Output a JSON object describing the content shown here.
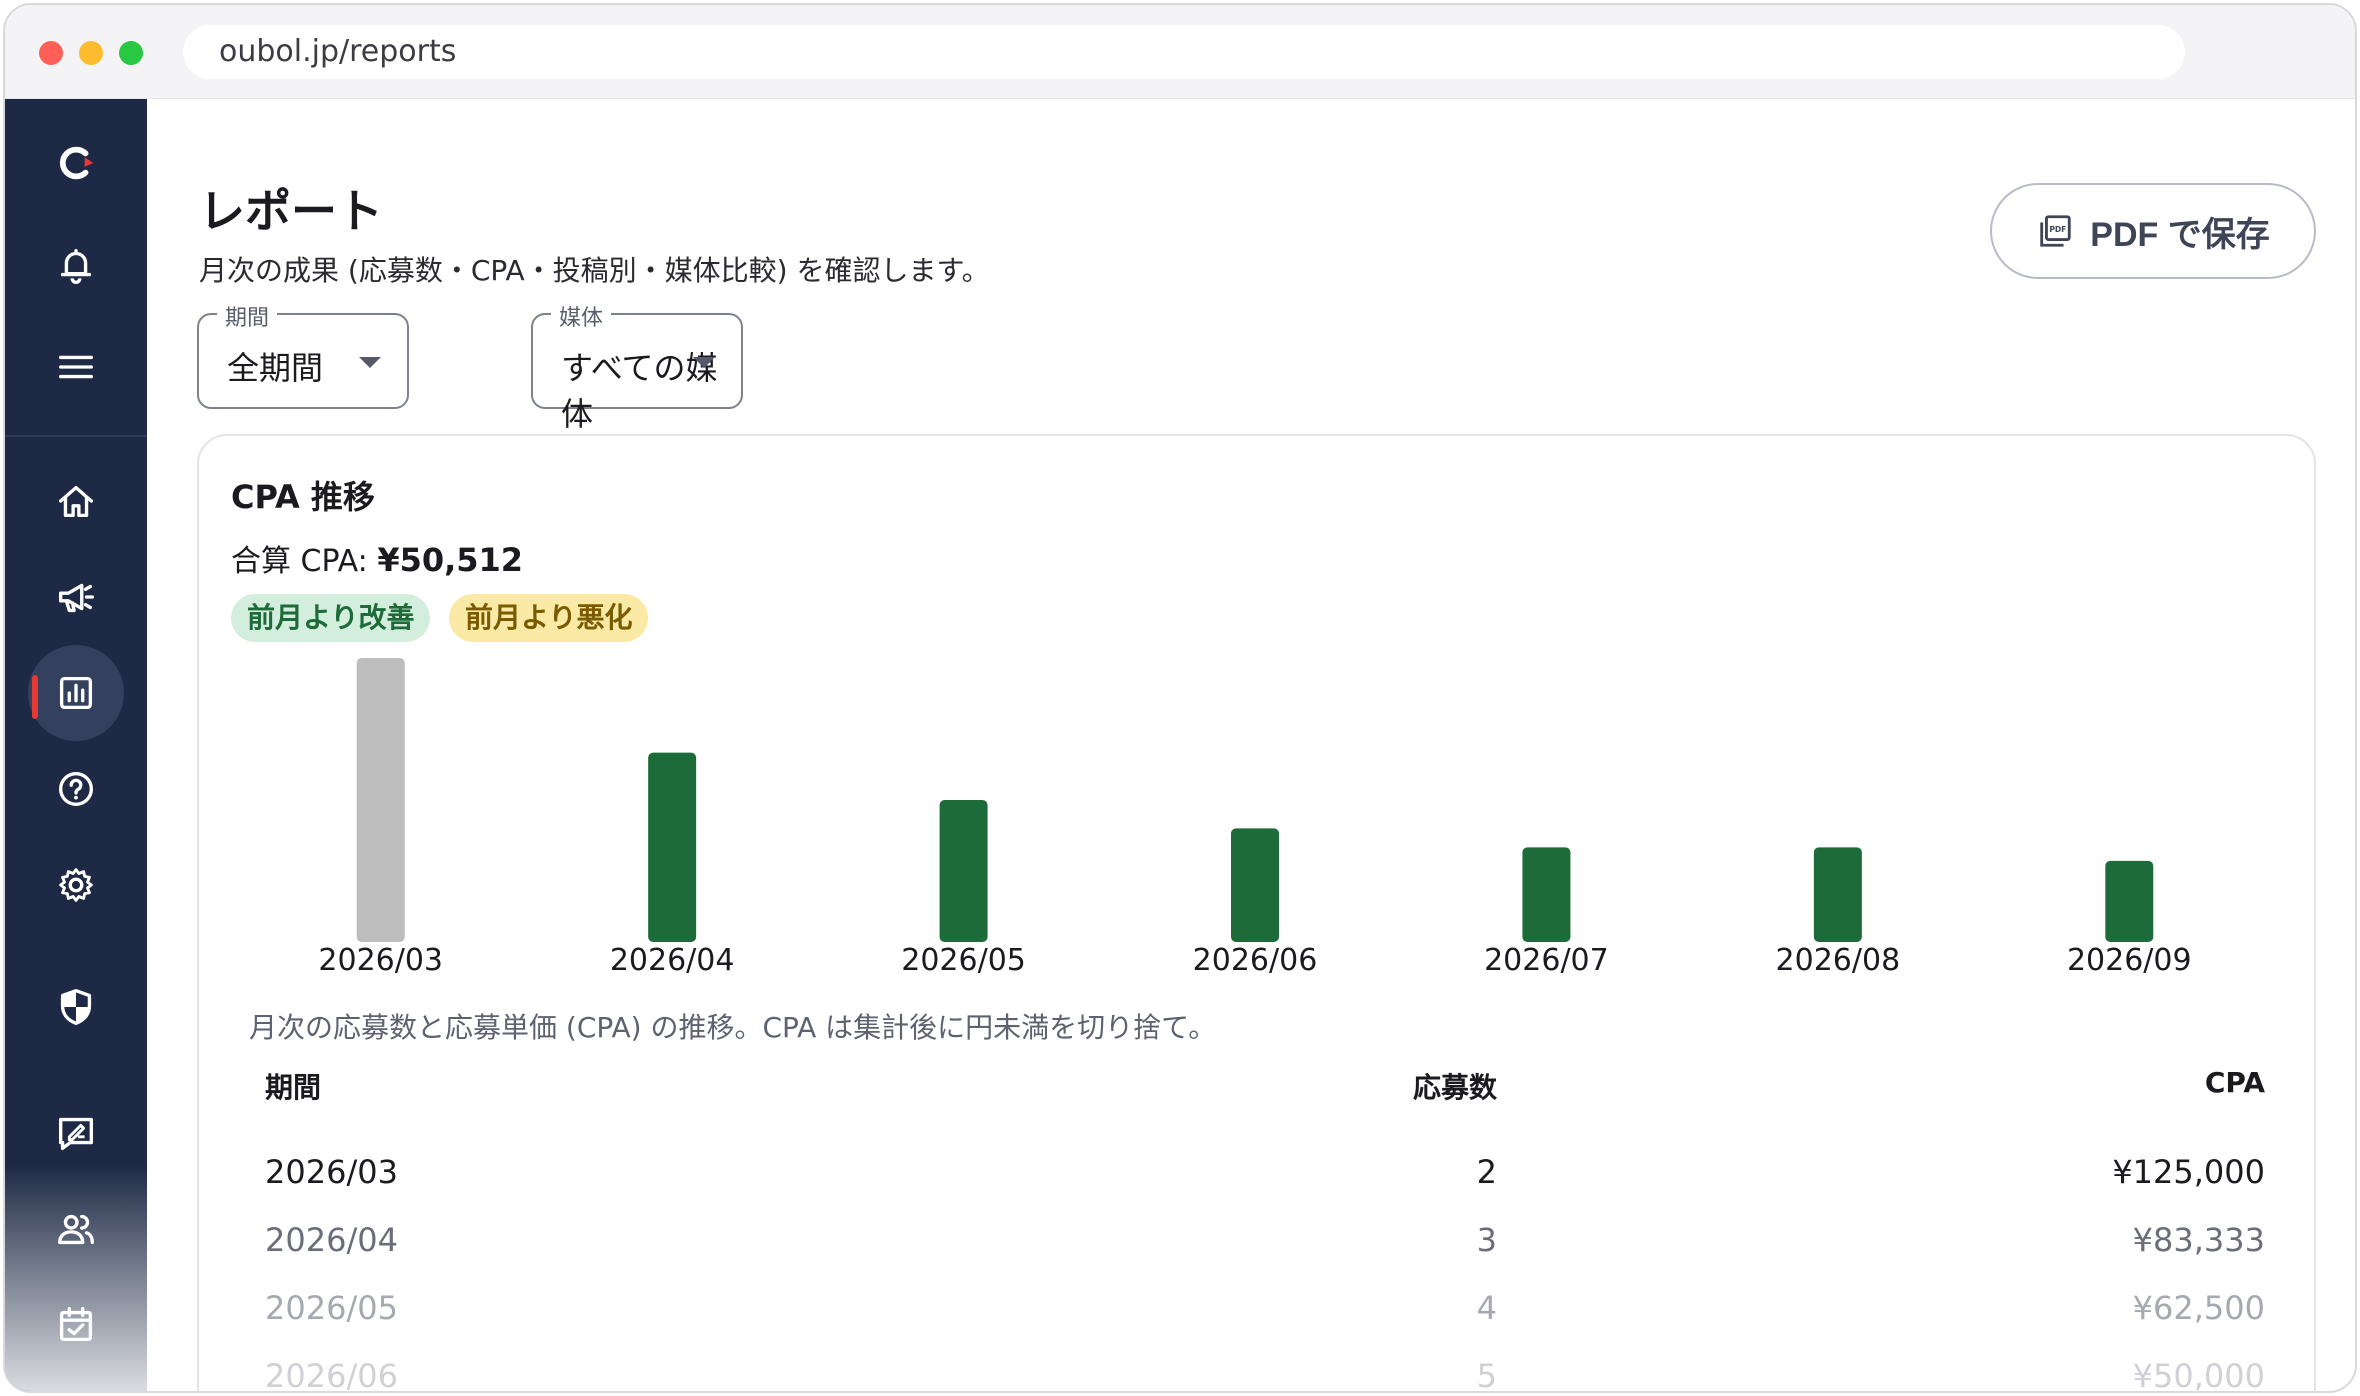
{
  "browser": {
    "url": "oubol.jp/reports"
  },
  "header": {
    "title": "レポート",
    "description": "月次の成果 (応募数・CPA・投稿別・媒体比較) を確認します。",
    "pdf_button": "PDF で保存"
  },
  "filters": {
    "period": {
      "label": "期間",
      "value": "全期間"
    },
    "media": {
      "label": "媒体",
      "value": "すべての媒体"
    }
  },
  "card": {
    "title": "CPA 推移",
    "total_label": "合算 CPA:",
    "total_value": "¥50,512",
    "chip_improved": "前月より改善",
    "chip_worsened": "前月より悪化",
    "note": "月次の応募数と応募単価 (CPA) の推移。CPA は集計後に円未満を切り捨て。"
  },
  "chart_data": {
    "type": "bar",
    "categories": [
      "2026/03",
      "2026/04",
      "2026/05",
      "2026/06",
      "2026/07",
      "2026/08",
      "2026/09"
    ],
    "values": [
      125000,
      83333,
      62500,
      50000,
      41666,
      41666,
      35714
    ],
    "bar_colors": [
      "#bdbdbd",
      "#1e6b3a",
      "#1e6b3a",
      "#1e6b3a",
      "#1e6b3a",
      "#1e6b3a",
      "#1e6b3a"
    ],
    "ylim": [
      0,
      125000
    ],
    "title": "",
    "xlabel": "",
    "ylabel": ""
  },
  "table": {
    "headers": {
      "period": "期間",
      "count": "応募数",
      "cpa": "CPA"
    },
    "rows": [
      {
        "period": "2026/03",
        "count": "2",
        "cpa": "¥125,000"
      },
      {
        "period": "2026/04",
        "count": "3",
        "cpa": "¥83,333"
      },
      {
        "period": "2026/05",
        "count": "4",
        "cpa": "¥62,500"
      },
      {
        "period": "2026/06",
        "count": "5",
        "cpa": "¥50,000"
      }
    ]
  },
  "sidebar": {
    "items": [
      {
        "icon": "logo-icon"
      },
      {
        "icon": "bell-icon"
      },
      {
        "icon": "menu-icon"
      },
      {
        "icon": "home-icon"
      },
      {
        "icon": "megaphone-icon"
      },
      {
        "icon": "chart-icon",
        "active": true
      },
      {
        "icon": "help-icon"
      },
      {
        "icon": "gear-icon"
      },
      {
        "icon": "shield-icon"
      },
      {
        "icon": "feedback-icon"
      },
      {
        "icon": "users-icon"
      },
      {
        "icon": "calendar-check-icon"
      }
    ]
  }
}
